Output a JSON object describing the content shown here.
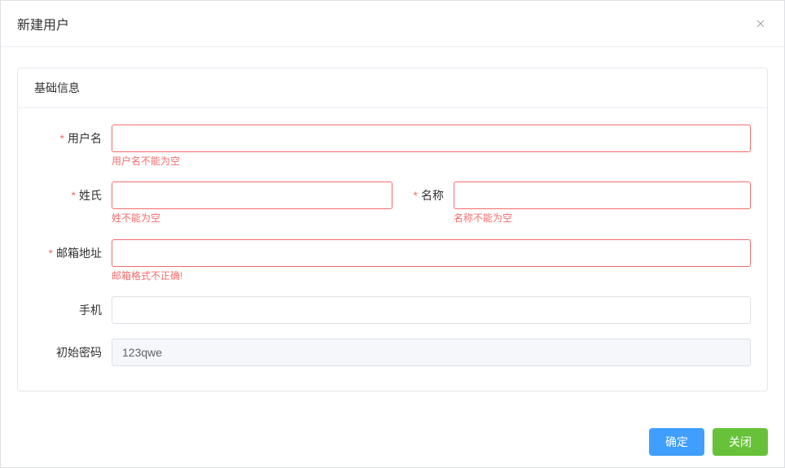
{
  "dialog": {
    "title": "新建用户"
  },
  "section": {
    "basic_info": "基础信息"
  },
  "form": {
    "username": {
      "label": "用户名",
      "value": "",
      "error": "用户名不能为空"
    },
    "lastname": {
      "label": "姓氏",
      "value": "",
      "error": "姓不能为空"
    },
    "firstname": {
      "label": "名称",
      "value": "",
      "error": "名称不能为空"
    },
    "email": {
      "label": "邮箱地址",
      "value": "",
      "error": "邮箱格式不正确!"
    },
    "phone": {
      "label": "手机",
      "value": ""
    },
    "password": {
      "label": "初始密码",
      "value": "123qwe"
    }
  },
  "footer": {
    "confirm": "确定",
    "close": "关闭"
  }
}
